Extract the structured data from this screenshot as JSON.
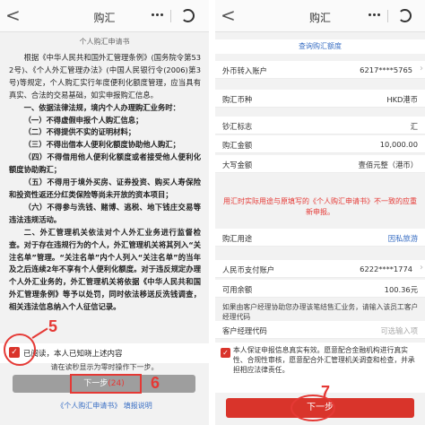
{
  "left": {
    "nav": {
      "back": "<",
      "title": "购汇"
    },
    "doc_title": "个人购汇申请书",
    "doc_lines": [
      "根据《中华人民共和国外汇管理条例》(国务院令第532号)、《个人外汇管理办法》(中国人民银行令(2006)第3号)等规定，个人购汇实行年度便利化额度管理，应当具有真实、合法的交易基础，如实申报购汇信息。",
      "一、依据法律法规，境内个人办理购汇业务时：",
      "（一）不得虚假申报个人购汇信息；",
      "（二）不得提供不实的证明材料；",
      "（三）不得出借本人便利化额度协助他人购汇；",
      "（四）不得借用他人便利化额度或者接受他人便利化额度协助购汇；",
      "（五）不得用于境外买房、证券投资、购买人寿保险和投资性返还分红类保险等尚未开放的资本项目；",
      "（六）不得参与洗钱、赌博、逃税、地下钱庄交易等违法违规活动。",
      "二、外汇管理机关依法对个人外汇业务进行监督检查。对于存在违规行为的个人，外汇管理机关将其列入“关注名单”管理。“关注名单”内个人列入“关注名单”的当年及之后连续2年不享有个人便利化额度。对于违反规定办理个人外汇业务的，外汇管理机关将依据《中华人民共和国外汇管理条例》等予以处罚，同时依法移送反洗钱调查，相关违法信息纳入个人征信记录。"
    ],
    "agree_label": "已阅读，本人已知晓上述内容",
    "hint": "请在读秒显示为零时操作下一步。",
    "next_label": "下一步",
    "countdown": "(24)",
    "links": "《个人购汇申请书》 填报说明",
    "anno_5": "5",
    "anno_6": "6"
  },
  "right": {
    "nav": {
      "back": "<",
      "title": "购汇"
    },
    "quota_link": "查询购汇额度",
    "rows": [
      {
        "label": "外币转入账户",
        "value": "6217****5765"
      },
      {
        "label": "购汇币种",
        "value": "HKD港币"
      },
      {
        "label": "钞汇标志",
        "value": "汇"
      },
      {
        "label": "购汇金额",
        "value": "10,000.00"
      },
      {
        "label": "大写金额",
        "value": "壹佰元整（港币）"
      },
      {
        "label": "购汇用途",
        "value": "因私旅游"
      },
      {
        "label": "人民币支付账户",
        "value": "6222****1774"
      },
      {
        "label": "可用余额",
        "value": "100.36元"
      },
      {
        "label": "客户经理代码",
        "value": "可选输入项"
      }
    ],
    "notice": "用汇时实际用途与原填写的《个人购汇申请书》不一致的应重新申报。",
    "advisor_note": "如果由客户经理协助您办理该笔结售汇业务，请输入该员工客户经理代码",
    "confirm_text": "本人保证申报信息真实有效。愿意配合金融机构进行真实性、合规性审核，愿意配合外汇管理机关调查和检查，并承担相应法律责任。",
    "next_label": "下一步",
    "anno_7": "7"
  }
}
